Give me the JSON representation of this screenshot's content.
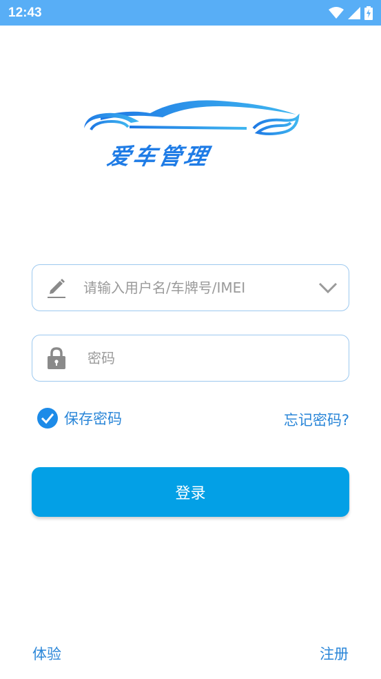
{
  "status_bar": {
    "time": "12:43",
    "icons": [
      "wifi-icon",
      "signal-icon",
      "battery-charging-icon"
    ],
    "background": "#58aef6"
  },
  "logo": {
    "text": "爱车管理",
    "color": "#1f7ce6",
    "icon": "car-silhouette-icon"
  },
  "username": {
    "placeholder": "请输入用户名/车牌号/IMEI",
    "value": "",
    "icon": "pencil-icon",
    "dropdown_icon": "chevron-down-icon"
  },
  "password": {
    "placeholder": "密码",
    "value": "",
    "icon": "lock-icon"
  },
  "remember": {
    "label": "保存密码",
    "checked": true,
    "icon": "check-circle-icon"
  },
  "forgot_label": "忘记密码?",
  "login_label": "登录",
  "footer": {
    "trial_label": "体验",
    "register_label": "注册"
  },
  "colors": {
    "accent": "#03a0e6",
    "link": "#2a86d8",
    "border": "#9cc8ef"
  }
}
